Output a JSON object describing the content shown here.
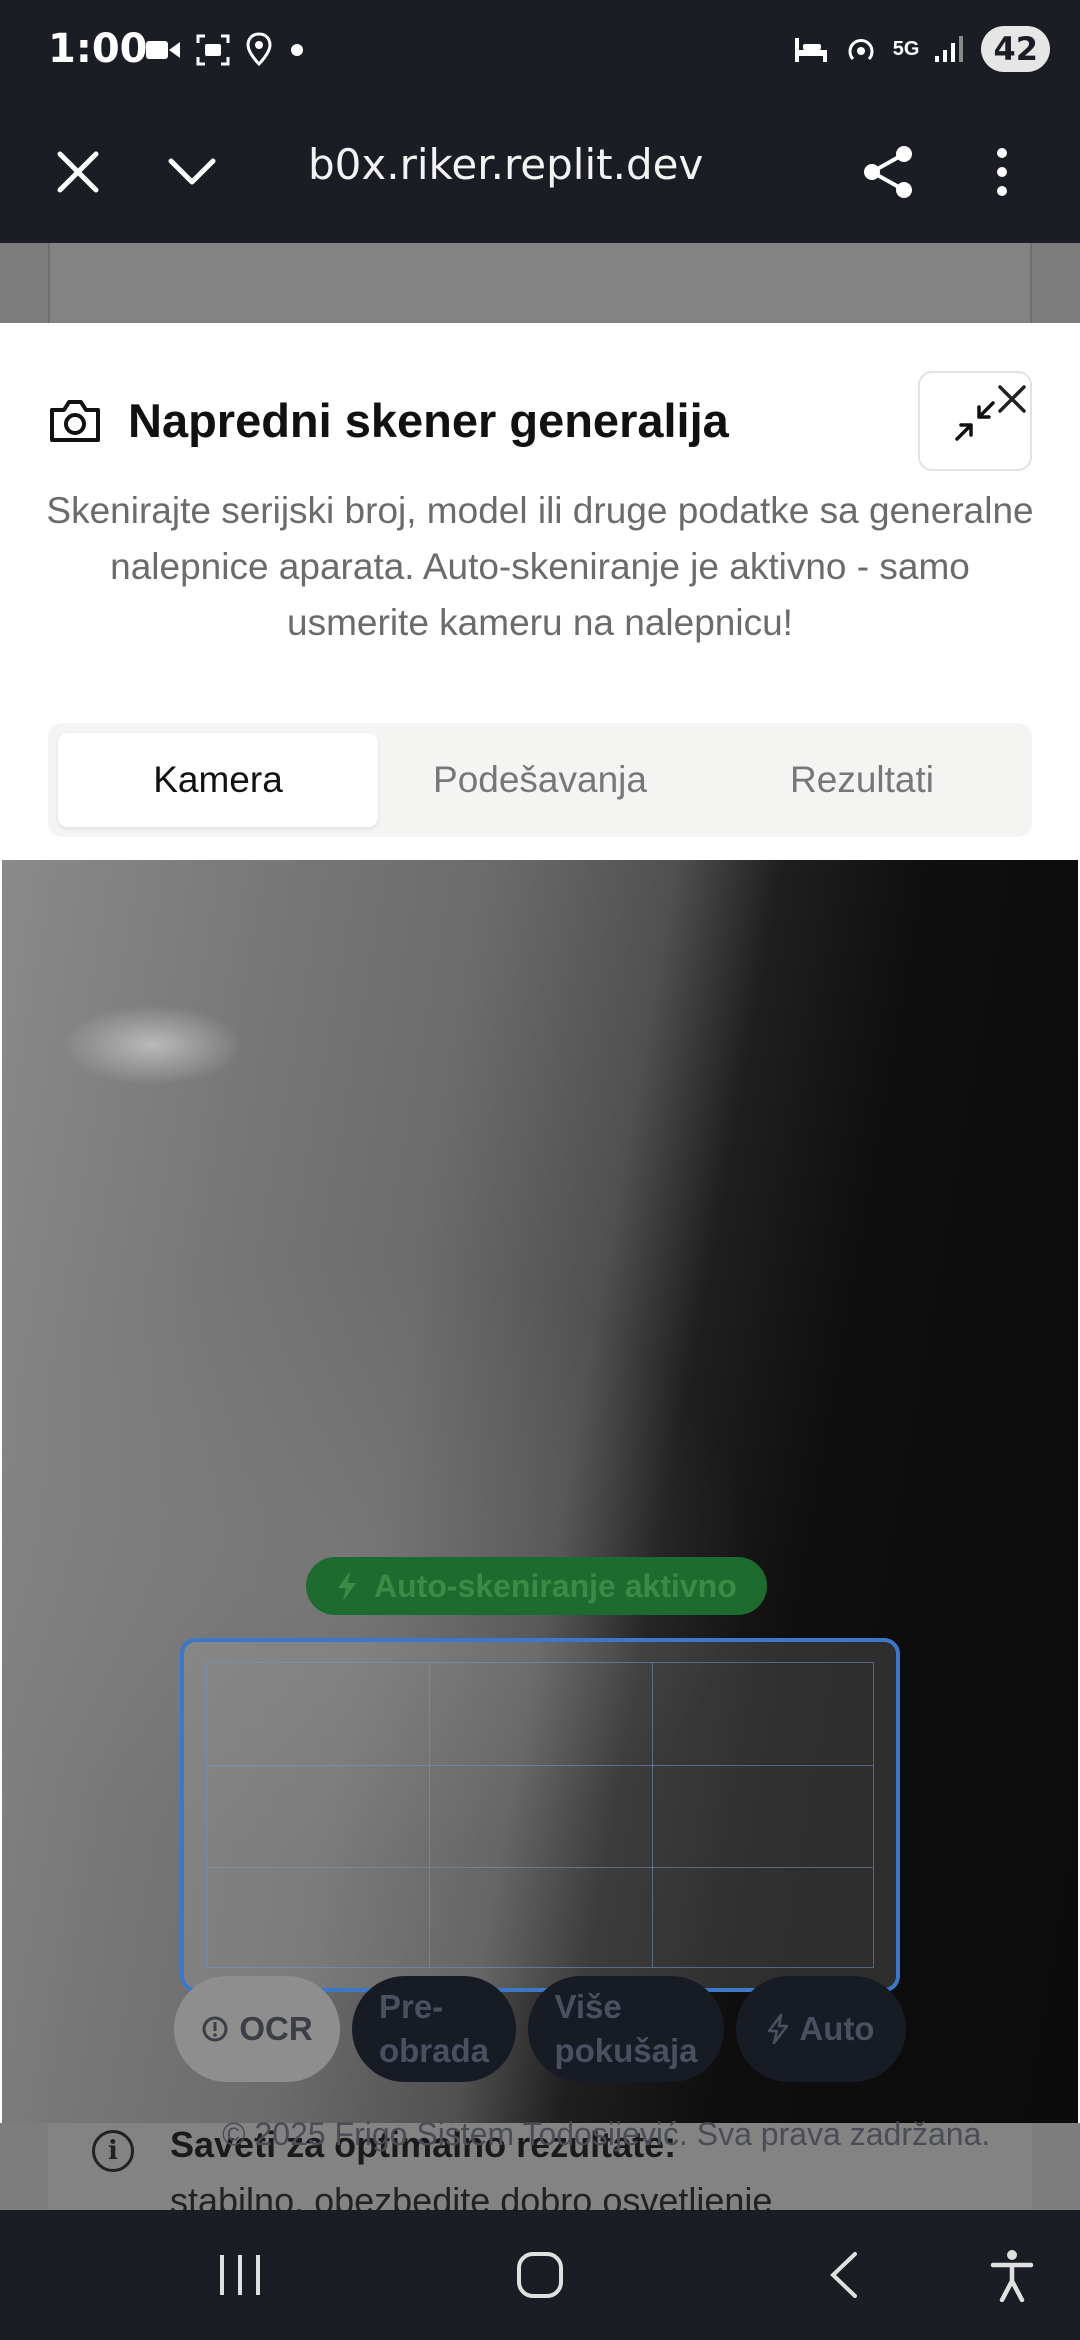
{
  "status_bar": {
    "time": "1:00",
    "network": "5G",
    "battery": "42"
  },
  "browser": {
    "url": "b0x.riker.replit.dev"
  },
  "dialog": {
    "title": "Napredni skener generalija",
    "description": "Skenirajte serijski broj, model ili druge podatke sa generalne nalepnice aparata. Auto-skeniranje je aktivno - samo usmerite kameru na nalepnicu!",
    "tabs": [
      {
        "label": "Kamera",
        "active": true
      },
      {
        "label": "Podešavanja",
        "active": false
      },
      {
        "label": "Rezultati",
        "active": false
      }
    ]
  },
  "camera": {
    "auto_status": "Auto-skeniranje aktivno",
    "buttons": {
      "ocr": "OCR",
      "preprocess_line1": "Pre-",
      "preprocess_line2": "obrada",
      "attempts_line1": "Više",
      "attempts_line2": "pokušaja",
      "auto": "Auto"
    }
  },
  "footer": {
    "copyright": "© 2025 Frigo Sistem Todosijević. Sva prava zadržana."
  },
  "background_page": {
    "tip_bold": "Saveti za optimalno rezultate:",
    "tip_text": "stabilno, obezbedite dobro osvetljenje"
  },
  "colors": {
    "accent_green": "#1e6b2f",
    "scan_blue": "#3d78c8",
    "dark_bar": "#1b1d24"
  }
}
